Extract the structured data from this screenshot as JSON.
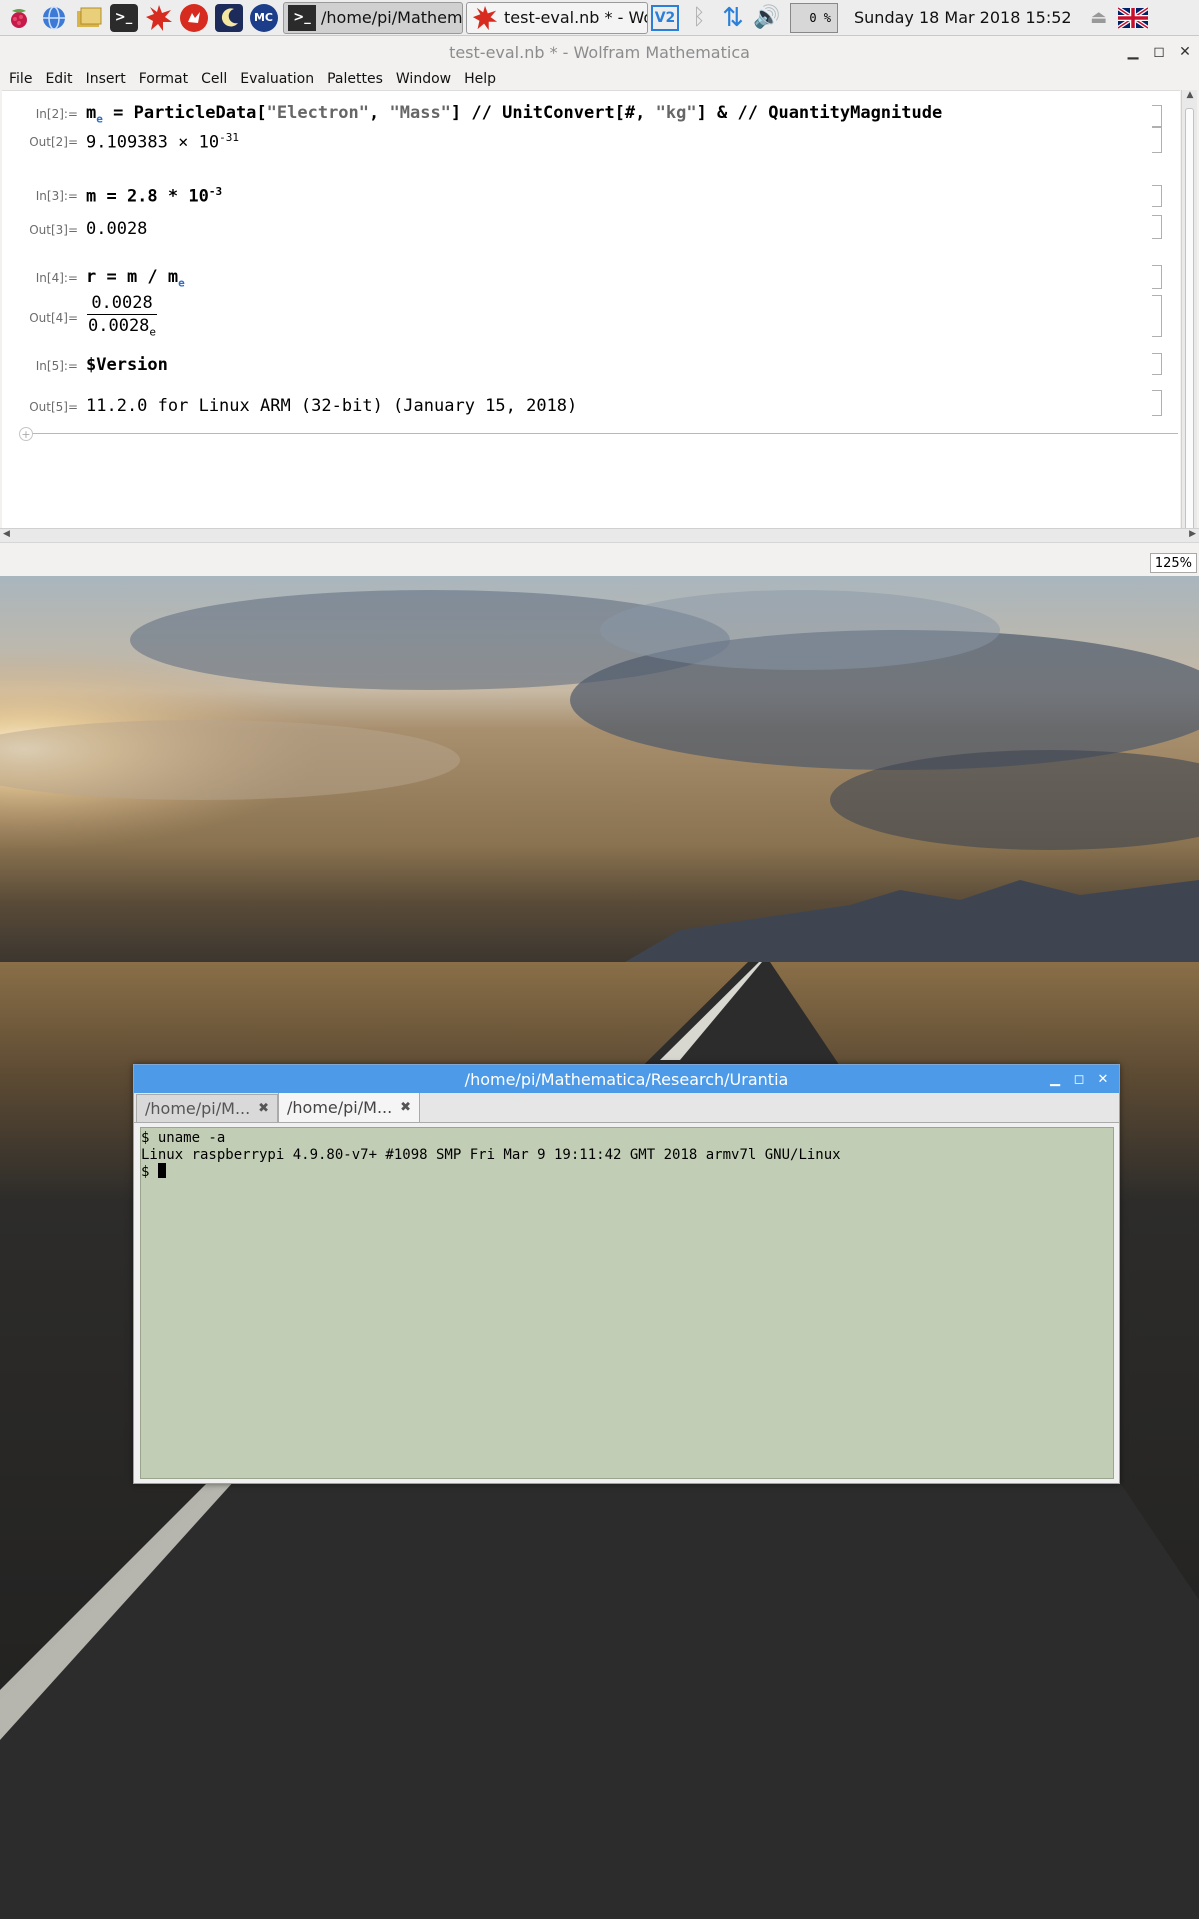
{
  "taskbar": {
    "launchers": [
      {
        "icon": "raspberry-icon",
        "color": "#c51a4a"
      },
      {
        "icon": "web-browser-icon",
        "color": "#3d7ad6"
      },
      {
        "icon": "file-manager-icon",
        "color": "#d9b44a"
      },
      {
        "icon": "terminal-icon",
        "color": "#2b2b2b"
      },
      {
        "icon": "mathematica-icon",
        "color": "#d62b1e"
      },
      {
        "icon": "wolfram-icon",
        "color": "#d62b1e"
      },
      {
        "icon": "night-sky-icon",
        "color": "#1c2b5a"
      },
      {
        "icon": "minecraft-icon",
        "color": "#1b3d8a"
      }
    ],
    "tasks": [
      {
        "label": "/home/pi/Mathem...",
        "icon": "terminal-icon",
        "active": true
      },
      {
        "label": "test-eval.nb * - Wol...",
        "icon": "mathematica-icon",
        "active": false
      }
    ],
    "tray": {
      "cpu": "0 %",
      "clock": "Sunday 18 Mar 2018 15:52"
    }
  },
  "mathematica": {
    "title": "test-eval.nb * - Wolfram Mathematica",
    "menu": [
      "File",
      "Edit",
      "Insert",
      "Format",
      "Cell",
      "Evaluation",
      "Palettes",
      "Window",
      "Help"
    ],
    "cells": [
      {
        "in_label": "In[2]:=",
        "out_label": "Out[2]="
      },
      {
        "in_label": "In[3]:=",
        "out_label": "Out[3]="
      },
      {
        "in_label": "In[4]:=",
        "out_label": "Out[4]="
      },
      {
        "in_label": "In[5]:=",
        "out_label": "Out[5]="
      }
    ],
    "in2": {
      "var": "m",
      "sub": "e",
      "eq": " = ",
      "fn": "ParticleData[",
      "arg1": "\"Electron\"",
      "comma": ", ",
      "arg2": "\"Mass\"",
      "rest1": "] // UnitConvert[#, ",
      "arg3": "\"kg\"",
      "rest2": "] & // QuantityMagnitude"
    },
    "out2": {
      "mantissa": "9.109383",
      "times": " × 10",
      "exp": "-31"
    },
    "in3": {
      "text": "m = 2.8 * 10",
      "exp": "-3"
    },
    "out3": {
      "text": "0.0028"
    },
    "in4": {
      "text": "r = m / m",
      "sub": "e"
    },
    "out4": {
      "num": "0.0028",
      "den": "0.0028",
      "den_sub": "e"
    },
    "in5": {
      "text": "$Version"
    },
    "out5": {
      "text": "11.2.0 for Linux ARM (32-bit) (January 15, 2018)"
    },
    "zoom": "125%"
  },
  "terminal": {
    "title": "/home/pi/Mathematica/Research/Urantia",
    "tabs": [
      {
        "label": "/home/pi/M...",
        "active": false
      },
      {
        "label": "/home/pi/M...",
        "active": true
      }
    ],
    "lines": [
      "$ uname -a",
      "Linux raspberrypi 4.9.80-v7+ #1098 SMP Fri Mar 9 19:11:42 GMT 2018 armv7l GNU/Linux",
      "$ "
    ]
  }
}
